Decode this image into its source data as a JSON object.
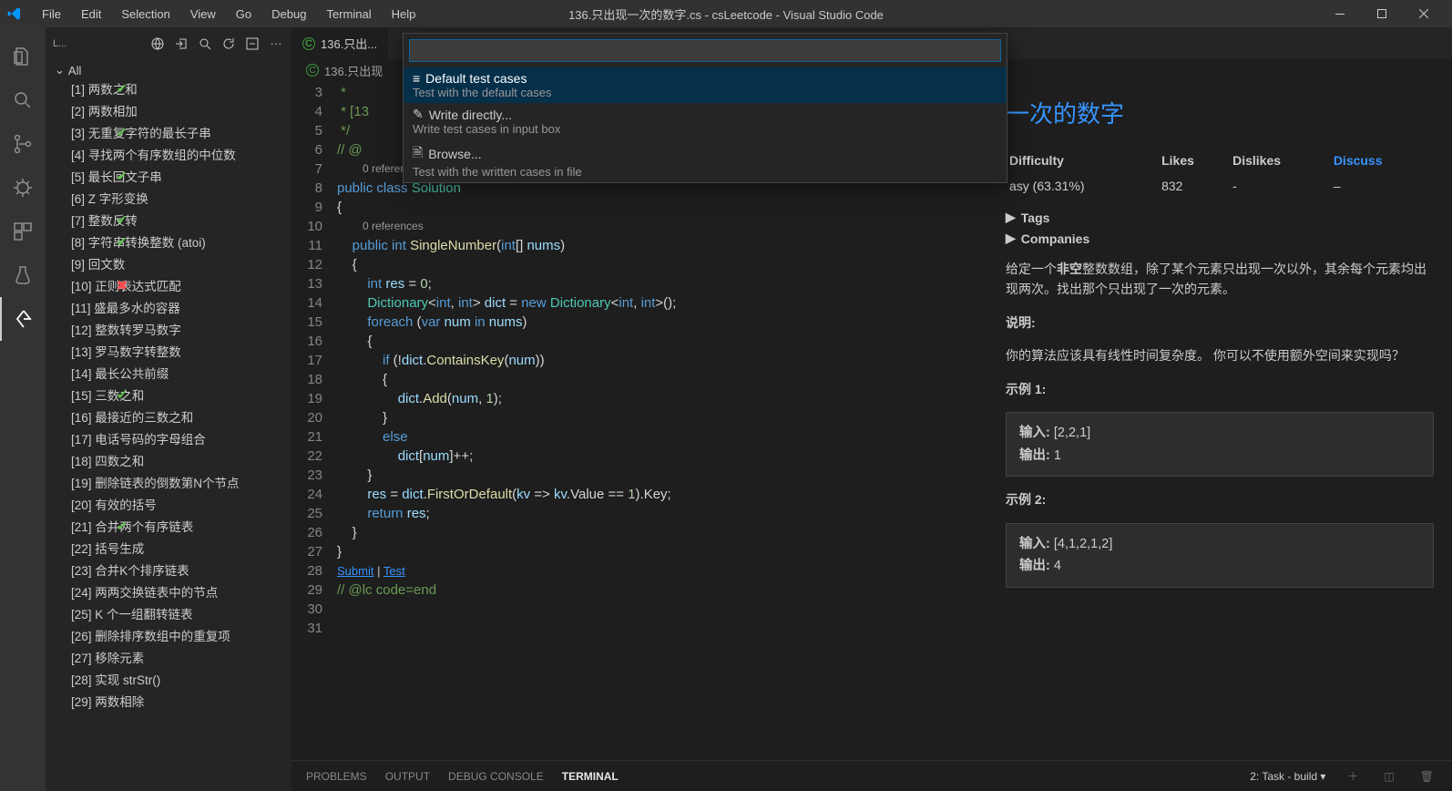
{
  "titlebar": {
    "menus": [
      "File",
      "Edit",
      "Selection",
      "View",
      "Go",
      "Debug",
      "Terminal",
      "Help"
    ],
    "title": "136.只出现一次的数字.cs - csLeetcode - Visual Studio Code"
  },
  "sidebar": {
    "toolbar_label": "L...",
    "root": "All",
    "items": [
      {
        "n": "[1] 两数之和",
        "s": "check"
      },
      {
        "n": "[2] 两数相加",
        "s": ""
      },
      {
        "n": "[3] 无重复字符的最长子串",
        "s": "check"
      },
      {
        "n": "[4] 寻找两个有序数组的中位数",
        "s": ""
      },
      {
        "n": "[5] 最长回文子串",
        "s": "check"
      },
      {
        "n": "[6] Z 字形变换",
        "s": ""
      },
      {
        "n": "[7] 整数反转",
        "s": "check"
      },
      {
        "n": "[8] 字符串转换整数 (atoi)",
        "s": "check"
      },
      {
        "n": "[9] 回文数",
        "s": ""
      },
      {
        "n": "[10] 正则表达式匹配",
        "s": "x"
      },
      {
        "n": "[11] 盛最多水的容器",
        "s": ""
      },
      {
        "n": "[12] 整数转罗马数字",
        "s": ""
      },
      {
        "n": "[13] 罗马数字转整数",
        "s": ""
      },
      {
        "n": "[14] 最长公共前缀",
        "s": ""
      },
      {
        "n": "[15] 三数之和",
        "s": "check"
      },
      {
        "n": "[16] 最接近的三数之和",
        "s": ""
      },
      {
        "n": "[17] 电话号码的字母组合",
        "s": ""
      },
      {
        "n": "[18] 四数之和",
        "s": ""
      },
      {
        "n": "[19] 删除链表的倒数第N个节点",
        "s": ""
      },
      {
        "n": "[20] 有效的括号",
        "s": ""
      },
      {
        "n": "[21] 合并两个有序链表",
        "s": "check"
      },
      {
        "n": "[22] 括号生成",
        "s": ""
      },
      {
        "n": "[23] 合并K个排序链表",
        "s": ""
      },
      {
        "n": "[24] 两两交换链表中的节点",
        "s": ""
      },
      {
        "n": "[25] K 个一组翻转链表",
        "s": ""
      },
      {
        "n": "[26] 删除排序数组中的重复项",
        "s": ""
      },
      {
        "n": "[27] 移除元素",
        "s": ""
      },
      {
        "n": "[28] 实现 strStr()",
        "s": ""
      },
      {
        "n": "[29] 两数相除",
        "s": ""
      }
    ]
  },
  "tabs": {
    "file": "136.只出..."
  },
  "breadcrumb": {
    "file": "136.只出现"
  },
  "quickinput": {
    "items": [
      {
        "icon": "≡",
        "label": "Default test cases",
        "desc": "Test with the default cases"
      },
      {
        "icon": "✎",
        "label": "Write directly...",
        "desc": "Write test cases in input box"
      },
      {
        "icon": "🗎",
        "label": "Browse...",
        "desc": "Test with the written cases in file"
      }
    ]
  },
  "code": {
    "codelens1": "0 references",
    "codelens2": "0 references",
    "submit": "Submit",
    "sep": " | ",
    "test": "Test",
    "lines": {
      "3": " * ",
      "4": " * [13",
      "5": " */",
      "6": "",
      "7a": "// @",
      "8": "public class Solution",
      "9": "{",
      "10": "    public int SingleNumber(int[] nums)",
      "11": "    {",
      "12": "        int res = 0;",
      "13": "        Dictionary<int, int> dict = new Dictionary<int, int>();",
      "14": "        foreach (var num in nums)",
      "15": "        {",
      "16": "            if (!dict.ContainsKey(num))",
      "17": "            {",
      "18": "                dict.Add(num, 1);",
      "19": "            }",
      "20": "            else",
      "21": "                dict[num]++;",
      "22": "        }",
      "23": "",
      "24": "        res = dict.FirstOrDefault(kv => kv.Value == 1).Key;",
      "25": "",
      "26": "        return res;",
      "27": "    }",
      "28": "}",
      "29": "// @lc code=end",
      "30": "",
      "31": ""
    }
  },
  "desc": {
    "title_suffix": "一次的数字",
    "th_diff": "Difficulty",
    "th_likes": "Likes",
    "th_dislikes": "Dislikes",
    "th_discuss": "Discuss",
    "td_diff": "asy (63.31%)",
    "td_likes": "832",
    "td_dislikes": "-",
    "td_discuss": "–",
    "tags": "Tags",
    "companies": "Companies",
    "p1_pre": "给定一个",
    "p1_bold": "非空",
    "p1_post": "整数数组，除了某个元素只出现一次以外，其余每个元素均出现两次。找出那个只出现了一次的元素。",
    "note_h": "说明:",
    "note_p": "你的算法应该具有线性时间复杂度。 你可以不使用额外空间来实现吗？",
    "ex1_h": "示例 1:",
    "ex1_in_label": "输入: ",
    "ex1_in_val": "[2,2,1]",
    "ex1_out_label": "输出: ",
    "ex1_out_val": "1",
    "ex2_h": "示例 2:",
    "ex2_in_val": "[4,1,2,1,2]",
    "ex2_out_val": "4"
  },
  "panel": {
    "tabs": [
      "PROBLEMS",
      "OUTPUT",
      "DEBUG CONSOLE",
      "TERMINAL"
    ],
    "active": 3,
    "terminal_select": "2: Task - build"
  }
}
